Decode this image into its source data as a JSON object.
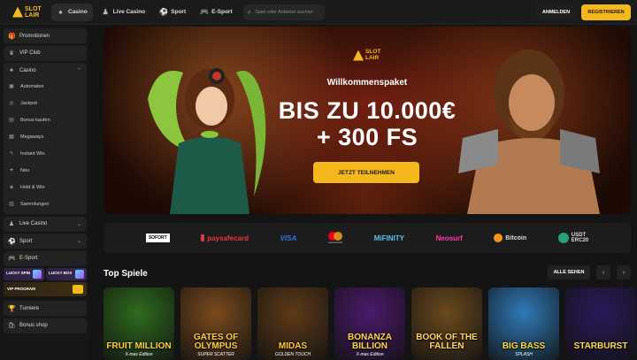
{
  "header": {
    "logo_line1": "SLOT",
    "logo_line2": "LAIR",
    "tabs": [
      {
        "label": "Casino",
        "icon": "casino-icon"
      },
      {
        "label": "Live Casino",
        "icon": "live-casino-icon"
      },
      {
        "label": "Sport",
        "icon": "sport-icon"
      },
      {
        "label": "E-Sport",
        "icon": "esport-icon"
      }
    ],
    "search_placeholder": "Spiel oder Anbieter suchen",
    "login_label": "ANMELDEN",
    "register_label": "REGISTRIEREN"
  },
  "sidebar": {
    "items_top": [
      {
        "label": "Promotionen",
        "icon": "gift-icon"
      },
      {
        "label": "VIP Club",
        "icon": "crown-icon"
      }
    ],
    "casino": {
      "label": "Casino",
      "subitems": [
        {
          "label": "Automaten",
          "icon": "slot-machine-icon"
        },
        {
          "label": "Jackpot",
          "icon": "jackpot-icon"
        },
        {
          "label": "Bonus kaufen",
          "icon": "bonus-buy-icon"
        },
        {
          "label": "Megaways",
          "icon": "megaways-icon"
        },
        {
          "label": "Instant Win",
          "icon": "lightning-icon"
        },
        {
          "label": "Neu",
          "icon": "new-icon"
        },
        {
          "label": "Hold & Win",
          "icon": "hold-win-icon"
        },
        {
          "label": "Sammlungen",
          "icon": "collections-icon"
        }
      ]
    },
    "items_mid": [
      {
        "label": "Live Casino",
        "icon": "live-casino-icon"
      },
      {
        "label": "Sport",
        "icon": "sport-icon"
      },
      {
        "label": "E-Sport",
        "icon": "esport-icon"
      }
    ],
    "promo_cards": {
      "lucky_spin": "LUCKY SPIN",
      "lucky_box": "LUCKY BOX",
      "vip_program": "VIP PROGRAM"
    },
    "items_bottom": [
      {
        "label": "Turniere",
        "icon": "trophy-icon"
      },
      {
        "label": "Bonus shop",
        "icon": "shop-icon"
      }
    ]
  },
  "hero": {
    "logo_line1": "SLOT",
    "logo_line2": "LAIR",
    "subtitle": "Willkommenspaket",
    "headline1": "BIS ZU 10.000€",
    "headline2": "+ 300 FS",
    "cta": "JETZT TEILNEHMEN"
  },
  "payments": {
    "sofort": "SOFORT",
    "paysafecard": "paysafecard",
    "visa": "VISA",
    "mastercard": "mastercard",
    "mifinity": "MiFINITY",
    "neosurf": "Neosurf",
    "bitcoin": "Bitcoin",
    "usdt": "USDT",
    "usdt_sub": "ERC20"
  },
  "games_section": {
    "title": "Top Spiele",
    "see_all": "ALLE SEHEN",
    "prev": "‹",
    "next": "›",
    "games": [
      {
        "title": "FRUIT MILLION",
        "sub": "X-mas Edition",
        "bg": "#2f6b1f",
        "color": "#ffd23a"
      },
      {
        "title": "GATES OF OLYMPUS",
        "sub": "SUPER SCATTER",
        "bg": "#7b4a1d",
        "color": "#ffcf4a"
      },
      {
        "title": "MIDAS",
        "sub": "GOLDEN TOUCH",
        "bg": "#5e3a18",
        "color": "#ffc93a"
      },
      {
        "title": "BONANZA BILLION",
        "sub": "X-mas Edition",
        "bg": "#4b1a6b",
        "color": "#ffd94a"
      },
      {
        "title": "BOOK OF THE FALLEN",
        "sub": "",
        "bg": "#6b4a1e",
        "color": "#ffd66b"
      },
      {
        "title": "BIG BASS",
        "sub": "SPLASH",
        "bg": "#2f7ab8",
        "color": "#ffde3a"
      },
      {
        "title": "STARBURST",
        "sub": "",
        "bg": "#2a1a5a",
        "color": "#ffdd55"
      }
    ]
  }
}
